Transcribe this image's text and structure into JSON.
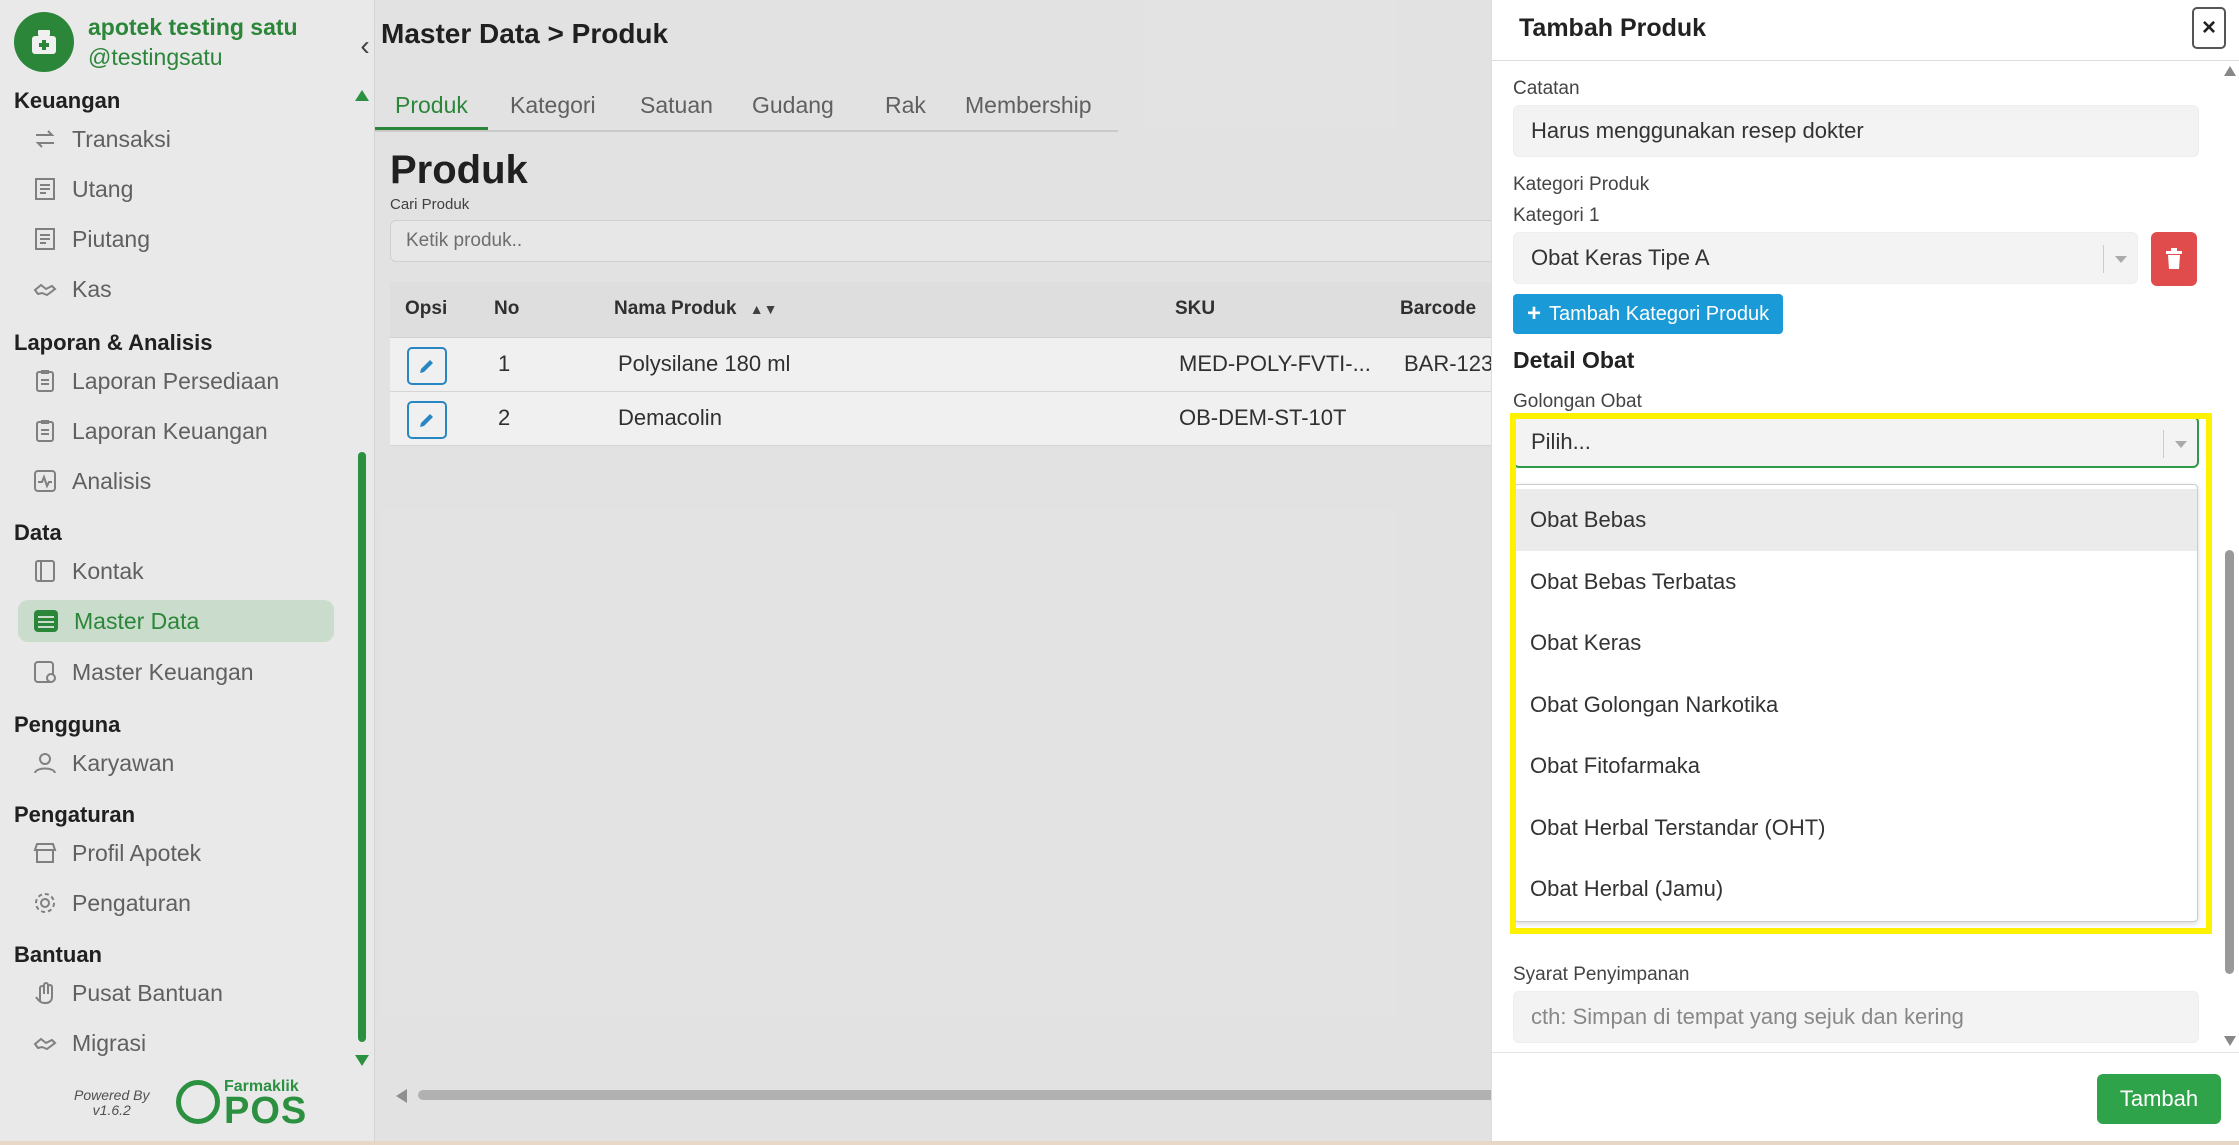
{
  "sidebar": {
    "store_name": "apotek testing satu",
    "store_handle": "@testingsatu",
    "sections": [
      {
        "title": "Keuangan",
        "items": [
          "Transaksi",
          "Utang",
          "Piutang",
          "Kas"
        ]
      },
      {
        "title": "Laporan & Analisis",
        "items": [
          "Laporan Persediaan",
          "Laporan Keuangan",
          "Analisis"
        ]
      },
      {
        "title": "Data",
        "items": [
          "Kontak",
          "Master Data",
          "Master Keuangan"
        ]
      },
      {
        "title": "Pengguna",
        "items": [
          "Karyawan"
        ]
      },
      {
        "title": "Pengaturan",
        "items": [
          "Profil Apotek",
          "Pengaturan"
        ]
      },
      {
        "title": "Bantuan",
        "items": [
          "Pusat Bantuan",
          "Migrasi"
        ]
      }
    ],
    "active_item": "Master Data",
    "powered_by": "Powered By",
    "version": "v1.6.2",
    "footer_brand_top": "Farmaklik",
    "footer_brand_pos": "POS"
  },
  "main": {
    "breadcrumb": "Master Data > Produk",
    "tabs": [
      "Produk",
      "Kategori",
      "Satuan",
      "Gudang",
      "Rak",
      "Membership"
    ],
    "active_tab": "Produk",
    "page_title": "Produk",
    "search_label": "Cari Produk",
    "search_placeholder": "Ketik produk..",
    "table": {
      "headers": [
        "Opsi",
        "No",
        "Nama Produk",
        "SKU",
        "Barcode"
      ],
      "rows": [
        {
          "no": "1",
          "name": "Polysilane 180 ml",
          "sku": "MED-POLY-FVTI-...",
          "barcode": "BAR-123"
        },
        {
          "no": "2",
          "name": "Demacolin",
          "sku": "OB-DEM-ST-10T",
          "barcode": ""
        }
      ]
    }
  },
  "drawer": {
    "title": "Tambah Produk",
    "close_label": "×",
    "catatan_label": "Catatan",
    "catatan_value": "Harus menggunakan resep dokter",
    "kategori_produk_label": "Kategori Produk",
    "kategori_1_label": "Kategori 1",
    "kategori_1_value": "Obat Keras Tipe A",
    "add_kategori_label": "Tambah Kategori Produk",
    "detail_obat_label": "Detail Obat",
    "golongan_label": "Golongan Obat",
    "golongan_value": "Pilih...",
    "golongan_options": [
      "Obat Bebas",
      "Obat Bebas Terbatas",
      "Obat Keras",
      "Obat Golongan Narkotika",
      "Obat Fitofarmaka",
      "Obat Herbal Terstandar (OHT)",
      "Obat Herbal (Jamu)"
    ],
    "syarat_label": "Syarat Penyimpanan",
    "syarat_placeholder": "cth: Simpan di tempat yang sejuk dan kering",
    "submit_label": "Tambah"
  },
  "colors": {
    "primary_green": "#2f8f3d",
    "info_blue": "#1a9ad6",
    "danger_red": "#e04b4b",
    "highlight_yellow": "#fff200"
  }
}
